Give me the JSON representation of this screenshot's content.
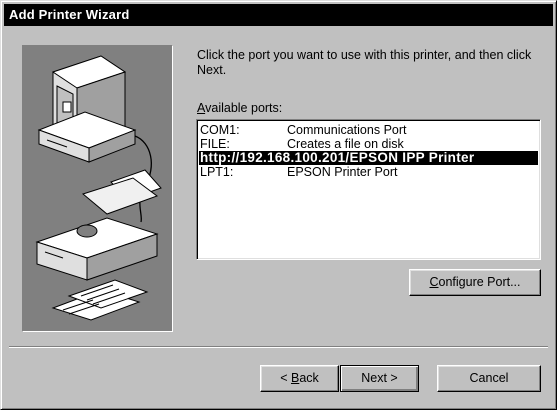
{
  "window": {
    "title": "Add Printer Wizard"
  },
  "instruction": "Click the port you want to use with this printer, and then click Next.",
  "ports_label": {
    "mnemonic": "A",
    "rest": "vailable ports:"
  },
  "ports": [
    {
      "port": "COM1:",
      "description": "Communications Port",
      "selected": false
    },
    {
      "port": "FILE:",
      "description": "Creates a file on disk",
      "selected": false
    },
    {
      "port": "http://192.168.100.201/EPSON IPP Printer",
      "description": "",
      "selected": true
    },
    {
      "port": "LPT1:",
      "description": "EPSON Printer Port",
      "selected": false
    }
  ],
  "buttons": {
    "configure": {
      "mnemonic": "C",
      "rest": "onfigure Port..."
    },
    "back": {
      "prefix": "< ",
      "mnemonic": "B",
      "rest": "ack"
    },
    "next": "Next >",
    "cancel": "Cancel"
  },
  "colors": {
    "face": "#c0c0c0",
    "titlebar": "#000000",
    "selection": "#000000",
    "illustration_bg": "#808080"
  }
}
